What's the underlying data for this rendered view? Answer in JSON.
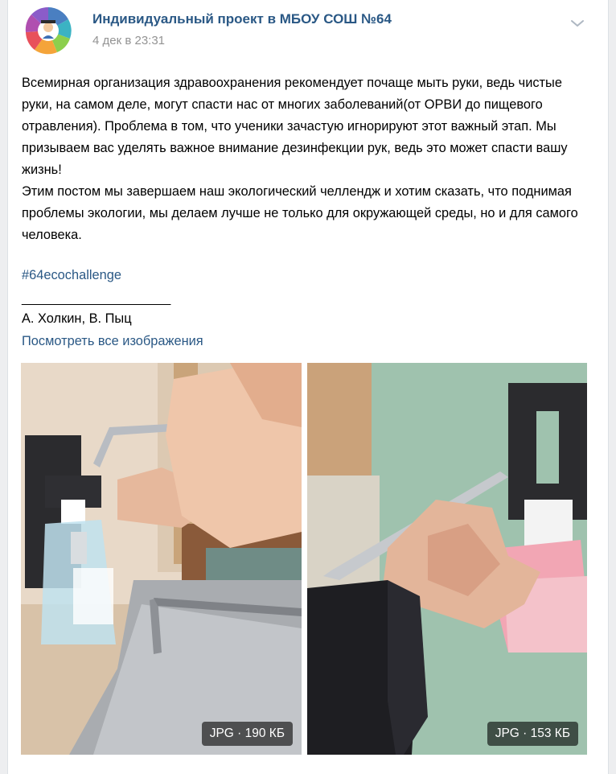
{
  "post": {
    "group_name": "Индивидуальный проект в МБОУ СОШ №64",
    "date": "4 дек в 23:31",
    "paragraphs": [
      "Всемирная организация здравоохранения рекомендует почаще мыть руки, ведь чистые руки, на самом деле, могут спасти нас от многих заболеваний(от ОРВИ до пищевого отравления). Проблема в том, что ученики зачастую игнорируют этот важный этап. Мы призываем вас уделять важное внимание дезинфекции рук, ведь это может спасти вашу жизнь!",
      "Этим постом мы завершаем наш экологический челлендж и хотим сказать, что поднимая проблемы экологии, мы делаем лучше не только для окружающей среды, но и для самого человека."
    ],
    "hashtag": "#64ecochallenge",
    "separator": "______________________",
    "authors": "А. Холкин, В. Пыц",
    "view_all": "Посмотреть все изображения"
  },
  "attachments": [
    {
      "label": "JPG · 190 КБ"
    },
    {
      "label": "JPG · 153 КБ"
    }
  ],
  "icons": {
    "avatar": "school-logo-avatar",
    "chevron": "chevron-down-icon"
  }
}
